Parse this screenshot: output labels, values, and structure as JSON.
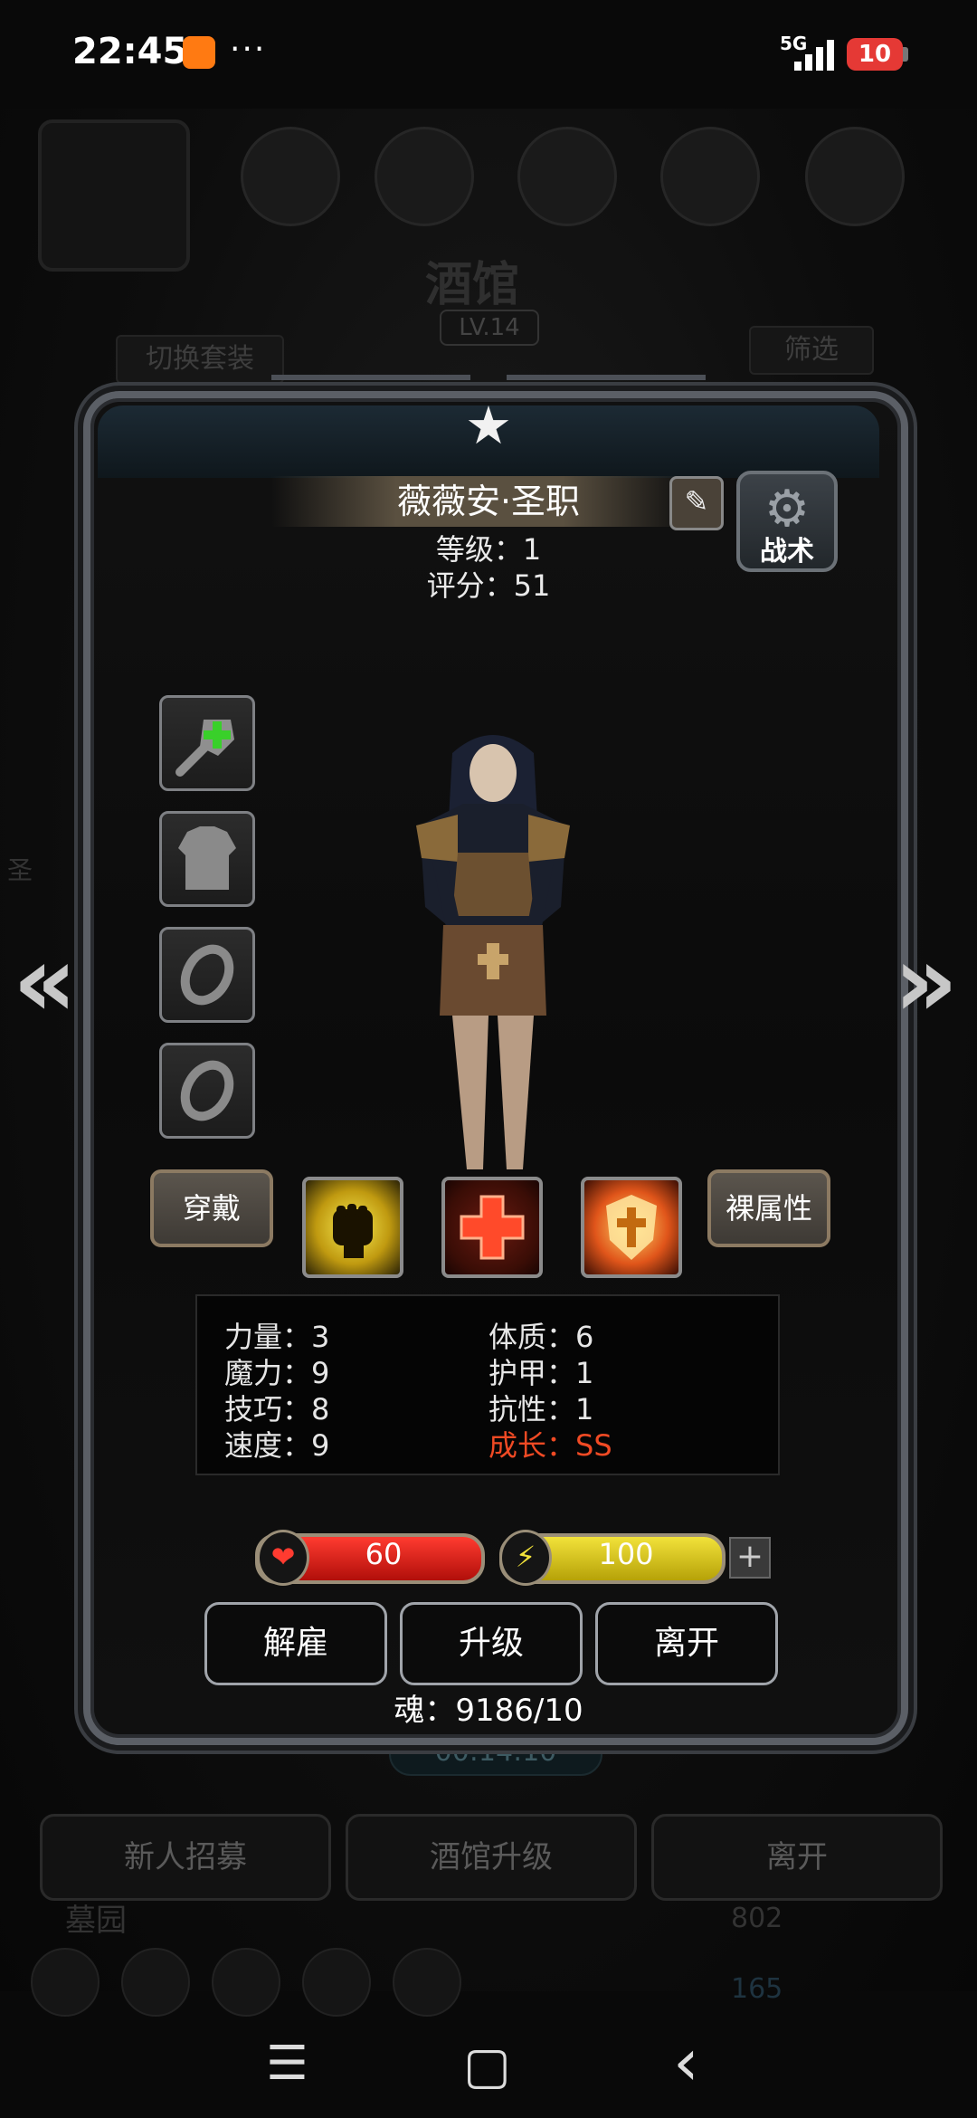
{
  "status_bar": {
    "time": "22:45",
    "dots": "···",
    "network": "5G",
    "battery": "10",
    "app_badge_color": "#ff7a12"
  },
  "background": {
    "title": "酒馆",
    "level": "LV.14",
    "switch_outfit": "切换套装",
    "filter": "筛选",
    "timer": "00:14:10",
    "buttons": [
      "新人招募",
      "酒馆升级",
      "离开"
    ],
    "tab_label": "墓园",
    "resource_1": "802",
    "resource_2": "165",
    "side_glyph": "圣"
  },
  "hero": {
    "name": "薇薇安·圣职",
    "level_text": "等级：1",
    "score_text": "评分：51",
    "tactics_label": "战术",
    "wear_label": "穿戴",
    "naked_stats_label": "裸属性"
  },
  "equipment_slots": [
    {
      "icon": "add-weapon-icon"
    },
    {
      "icon": "armor-silhouette-icon"
    },
    {
      "icon": "ring-icon"
    },
    {
      "icon": "ring-icon"
    }
  ],
  "skills": [
    {
      "icon": "fist-skill-icon",
      "color": "#f0d21a"
    },
    {
      "icon": "cross-heal-skill-icon",
      "color": "#e8361d"
    },
    {
      "icon": "holy-shield-skill-icon",
      "color": "#f0a020"
    }
  ],
  "stats": {
    "strength": "力量：3",
    "constitution": "体质：6",
    "magic": "魔力：9",
    "armor": "护甲：1",
    "skill": "技巧：8",
    "resistance": "抗性：1",
    "speed": "速度：9",
    "growth": "成长：SS",
    "growth_color": "#f04a24"
  },
  "bars": {
    "hp": "60",
    "energy": "100",
    "plus": "+"
  },
  "actions": {
    "dismiss": "解雇",
    "upgrade": "升级",
    "leave": "离开"
  },
  "soul": "魂：9186/10",
  "nav": {
    "menu": "☰",
    "home": "▢",
    "back": "‹"
  },
  "arrows": {
    "left": "«",
    "right": "»"
  }
}
